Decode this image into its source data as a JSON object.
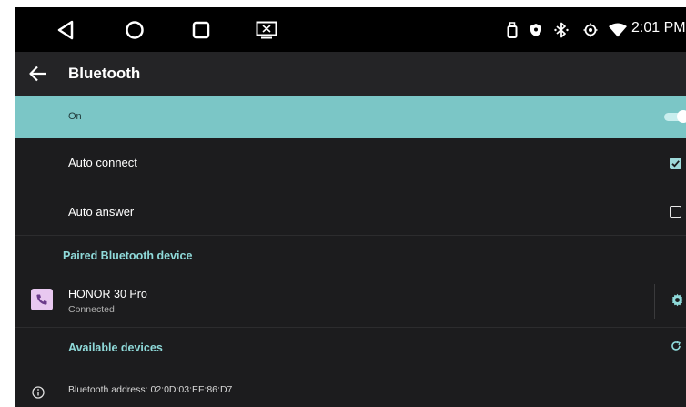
{
  "status_bar": {
    "time": "2:01 PM",
    "nav_icons": [
      "back-triangle-icon",
      "home-circle-icon",
      "recents-square-icon",
      "screen-cast-icon"
    ],
    "status_icons": [
      "usb-icon",
      "location-shield-icon",
      "bluetooth-icon",
      "gps-icon",
      "wifi-icon"
    ]
  },
  "app_bar": {
    "title": "Bluetooth",
    "back_icon": "arrow-left-icon"
  },
  "settings": {
    "bluetooth_toggle": {
      "label": "On",
      "enabled": true
    },
    "auto_connect": {
      "label": "Auto connect",
      "checked": true
    },
    "auto_answer": {
      "label": "Auto answer",
      "checked": false
    }
  },
  "paired": {
    "header": "Paired Bluetooth device",
    "devices": [
      {
        "name": "HONOR 30 Pro",
        "status": "Connected",
        "icon": "phone-icon"
      }
    ]
  },
  "available": {
    "header": "Available devices",
    "refresh_icon": "refresh-icon"
  },
  "footer": {
    "address_text": "Bluetooth address: 02:0D:03:EF:86:D7",
    "info_icon": "info-icon"
  },
  "colors": {
    "accent": "#7bc6c6",
    "section_header": "#8fdada",
    "background": "#1c1c1e",
    "app_bar": "#242426",
    "status_bar": "#000000"
  }
}
